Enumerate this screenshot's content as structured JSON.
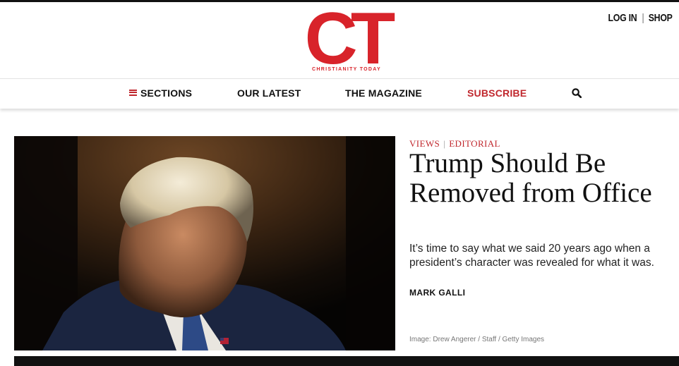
{
  "brand": {
    "logo_text": "CT",
    "tagline": "CHRISTIANITY TODAY",
    "color": "#d8232a"
  },
  "account": {
    "login": "LOG IN",
    "separator": "|",
    "shop": "SHOP"
  },
  "nav": {
    "sections": "SECTIONS",
    "latest": "OUR LATEST",
    "magazine": "THE MAGAZINE",
    "subscribe": "SUBSCRIBE",
    "search_icon": "search-icon",
    "menu_icon": "hamburger-menu-icon"
  },
  "article": {
    "kicker_views": "VIEWS",
    "kicker_sep": "|",
    "kicker_editorial": "EDITORIAL",
    "headline": "Trump Should Be Removed from Office",
    "dek": "It’s time to say what we said 20 years ago when a president’s character was revealed for what it was.",
    "byline": "MARK GALLI",
    "image_credit": "Image: Drew Angerer / Staff / Getty Images",
    "accent": "#c0272d"
  }
}
